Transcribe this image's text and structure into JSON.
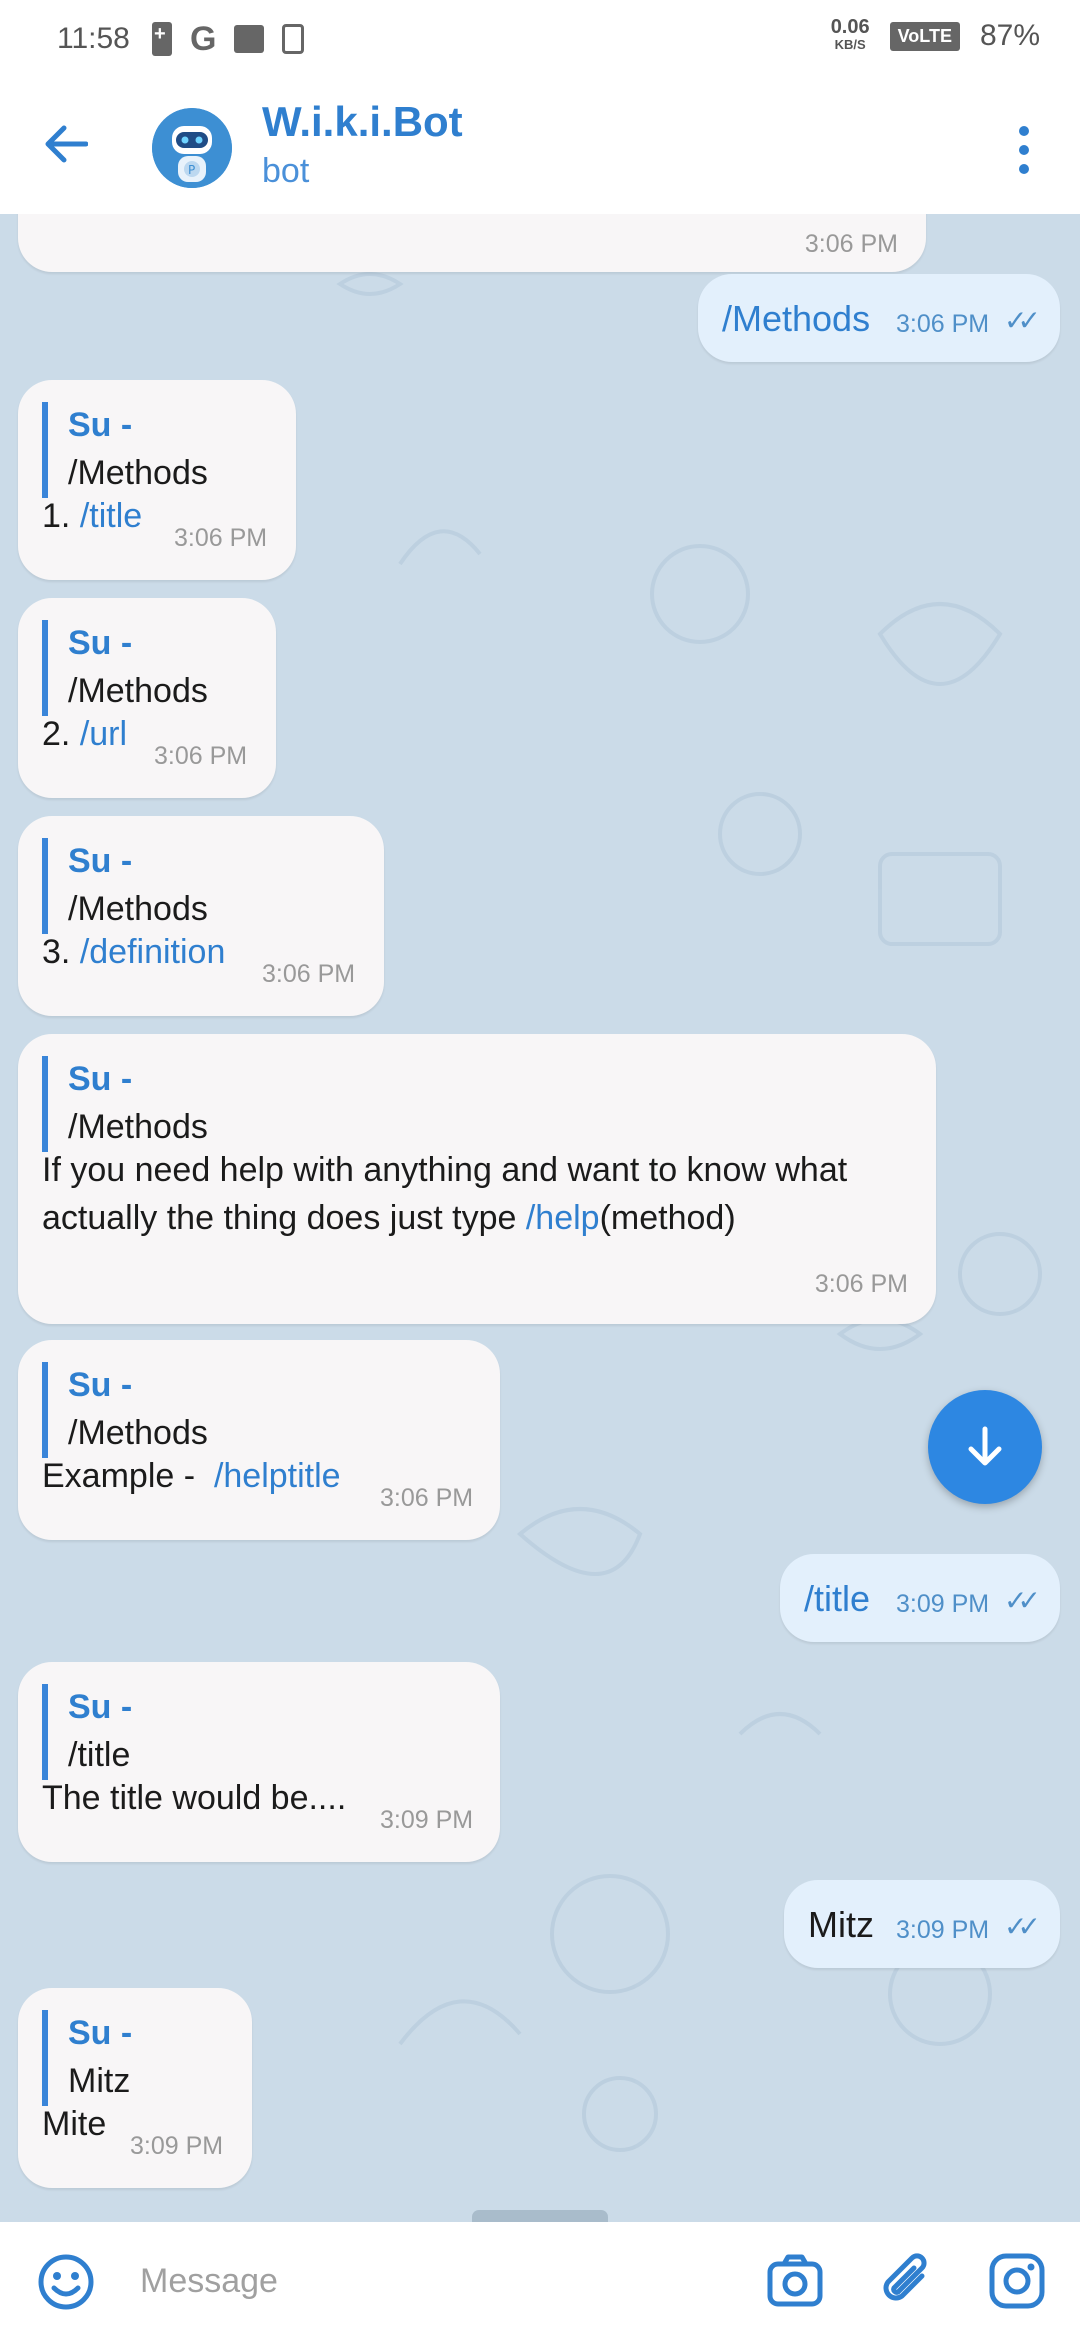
{
  "status_bar": {
    "time": "11:58",
    "net_speed": "0.06",
    "net_unit": "KB/S",
    "volte": "VoLTE",
    "battery": "87%"
  },
  "header": {
    "title": "W.i.k.i.Bot",
    "subtitle": "bot"
  },
  "messages": {
    "top_partial_time": "3:06 PM",
    "out1": {
      "text": "/Methods",
      "time": "3:06 PM"
    },
    "in1": {
      "reply_author": "Su -",
      "reply_text": "/Methods",
      "num": "1. ",
      "cmd": "/title",
      "time": "3:06 PM"
    },
    "in2": {
      "reply_author": "Su -",
      "reply_text": "/Methods",
      "num": "2. ",
      "cmd": "/url",
      "time": "3:06 PM"
    },
    "in3": {
      "reply_author": "Su -",
      "reply_text": "/Methods",
      "num": "3. ",
      "cmd": "/definition",
      "time": "3:06 PM"
    },
    "in4": {
      "reply_author": "Su -",
      "reply_text": "/Methods",
      "line1": "If you need help with anything and want to know what",
      "line2_pre": "actually the thing does just type ",
      "line2_cmd": "/help",
      "line2_post": "(method)",
      "time": "3:06 PM"
    },
    "in5": {
      "reply_author": "Su -",
      "reply_text": "/Methods",
      "pre": "Example -  ",
      "cmd": "/helptitle",
      "time": "3:06 PM"
    },
    "out2": {
      "text": "/title",
      "time": "3:09 PM"
    },
    "in6": {
      "reply_author": "Su -",
      "reply_text": "/title",
      "text": "The title would be....",
      "time": "3:09 PM"
    },
    "out3": {
      "text": "Mitz",
      "time": "3:09 PM"
    },
    "in7": {
      "reply_author": "Su -",
      "reply_text": "Mitz",
      "text": "Mite",
      "time": "3:09 PM"
    }
  },
  "input": {
    "placeholder": "Message"
  }
}
